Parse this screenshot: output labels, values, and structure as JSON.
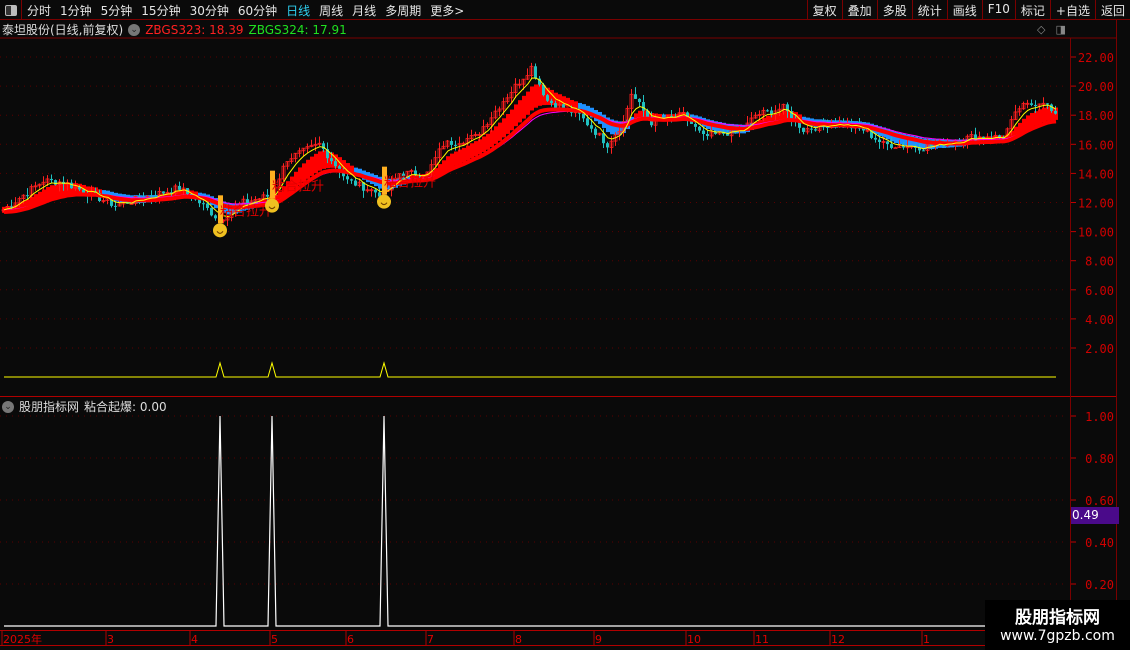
{
  "toolbar": {
    "periods": [
      "分时",
      "1分钟",
      "5分钟",
      "15分钟",
      "30分钟",
      "60分钟",
      "日线",
      "周线",
      "月线",
      "多周期",
      "更多>"
    ],
    "active": "日线",
    "buttons": [
      "复权",
      "叠加",
      "多股",
      "统计",
      "画线",
      "F10",
      "标记",
      "+自选",
      "返回"
    ]
  },
  "info": {
    "title": "泰坦股份(日线,前复权)",
    "zbgs323": "ZBGS323: 18.39",
    "zbgs324": "ZBGS324: 17.91"
  },
  "lower": {
    "title": "股朋指标网",
    "indicator": "粘合起爆: 0.00",
    "cursor_value": "0.49"
  },
  "watermark": {
    "line1": "股朋指标网",
    "line2": "www.7gpzb.com"
  },
  "colors": {
    "up": "#ff2020",
    "down": "#20c0c0",
    "axis": "#c00000",
    "ma_red": "#ff0000",
    "ma_blue": "#1e90ff",
    "ma_yellow": "#ffff00",
    "ma_magenta": "#ff00ff"
  },
  "chart_data": [
    {
      "type": "candlestick",
      "title": "泰坦股份 日线",
      "ylim": [
        0,
        23
      ],
      "yticks": [
        "2.00",
        "4.00",
        "6.00",
        "8.00",
        "10.00",
        "12.00",
        "14.00",
        "16.00",
        "18.00",
        "20.00",
        "22.00"
      ],
      "bars": 264,
      "close_waypoints": [
        [
          0,
          11.5
        ],
        [
          10,
          13.5
        ],
        [
          15,
          13.4
        ],
        [
          28,
          11.8
        ],
        [
          44,
          13
        ],
        [
          50,
          11.8
        ],
        [
          54,
          10.8
        ],
        [
          60,
          12
        ],
        [
          67,
          12.5
        ],
        [
          71,
          15
        ],
        [
          79,
          16
        ],
        [
          86,
          13.5
        ],
        [
          95,
          12.5
        ],
        [
          99,
          14
        ],
        [
          106,
          14
        ],
        [
          110,
          16
        ],
        [
          118,
          16.5
        ],
        [
          125,
          19
        ],
        [
          132,
          21.3
        ],
        [
          136,
          19
        ],
        [
          144,
          18
        ],
        [
          151,
          16
        ],
        [
          155,
          17.5
        ],
        [
          157,
          19.5
        ],
        [
          162,
          17.5
        ],
        [
          170,
          18
        ],
        [
          175,
          16.5
        ],
        [
          185,
          17
        ],
        [
          188,
          18
        ],
        [
          195,
          18.5
        ],
        [
          200,
          17
        ],
        [
          208,
          17.5
        ],
        [
          215,
          17
        ],
        [
          220,
          16
        ],
        [
          230,
          15.8
        ],
        [
          242,
          16.5
        ],
        [
          250,
          16.5
        ],
        [
          254,
          18.5
        ],
        [
          260,
          19
        ],
        [
          264,
          17.5
        ]
      ],
      "signal_label": "粘合拉升",
      "signal_bars": [
        54,
        67,
        95
      ],
      "x_labels": [
        {
          "bar": 0,
          "label": "2025年"
        },
        {
          "bar": 26,
          "label": "3"
        },
        {
          "bar": 47,
          "label": "4"
        },
        {
          "bar": 67,
          "label": "5"
        },
        {
          "bar": 86,
          "label": "6"
        },
        {
          "bar": 106,
          "label": "7"
        },
        {
          "bar": 128,
          "label": "8"
        },
        {
          "bar": 148,
          "label": "9"
        },
        {
          "bar": 171,
          "label": "10"
        },
        {
          "bar": 188,
          "label": "11"
        },
        {
          "bar": 207,
          "label": "12"
        },
        {
          "bar": 230,
          "label": "1"
        }
      ]
    },
    {
      "type": "line",
      "title": "粘合起爆",
      "ylim": [
        0,
        1.05
      ],
      "yticks": [
        "0.20",
        "0.40",
        "0.60",
        "0.80",
        "1.00"
      ],
      "spike_bars": [
        54,
        67,
        95
      ],
      "spike_value": 1.0
    }
  ]
}
